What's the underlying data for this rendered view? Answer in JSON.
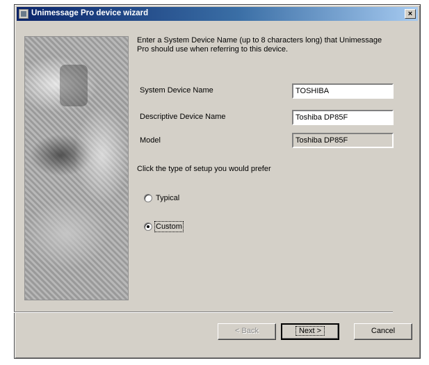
{
  "window": {
    "title": "Unimessage Pro device wizard",
    "close_label": "×"
  },
  "intro_text": "Enter a System Device Name (up to 8 characters long) that Unimessage Pro should use when referring to this device.",
  "fields": [
    {
      "label": "System Device Name",
      "value": "TOSHIBA",
      "readonly": false
    },
    {
      "label": "Descriptive Device Name",
      "value": "Toshiba DP85F",
      "readonly": false
    },
    {
      "label": "Model",
      "value": "Toshiba DP85F",
      "readonly": true
    }
  ],
  "setup_prompt": "Click the type of setup you would prefer",
  "options": [
    {
      "label": "Typical",
      "selected": false
    },
    {
      "label": "Custom",
      "selected": true
    }
  ],
  "buttons": {
    "back": "< Back",
    "next": "Next >",
    "cancel": "Cancel"
  }
}
